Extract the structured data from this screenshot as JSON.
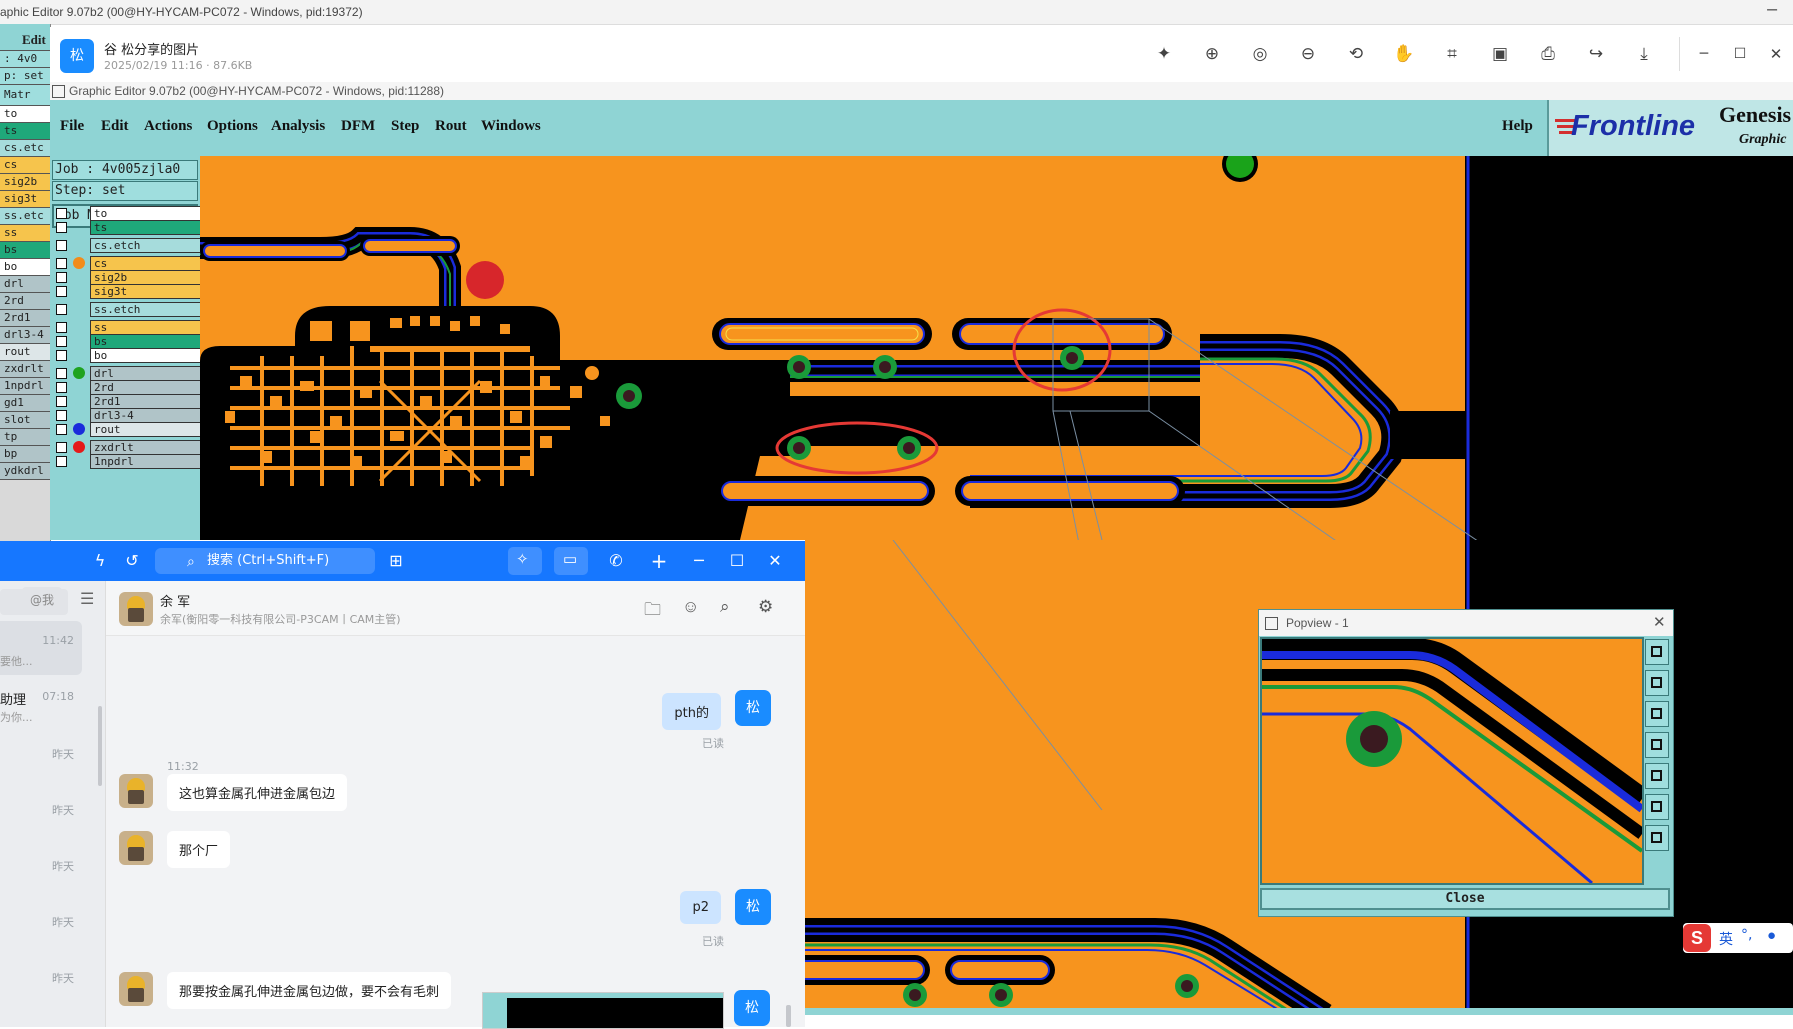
{
  "back_window": {
    "title": "aphic Editor 9.07b2 (00@HY-HYCAM-PC072 - Windows, pid:19372)",
    "menu_edit": "Edit",
    "job_fragment": ": 4v0",
    "step_fragment": "p: set",
    "matrix_fragment": "Matr",
    "layers": [
      "to",
      "ts",
      "cs.etc",
      "cs",
      "sig2b",
      "sig3t",
      "ss.etc",
      "ss",
      "bs",
      "bo",
      "drl",
      "2rd",
      "2rd1",
      "drl3-4",
      "rout",
      "zxdrlt",
      "1npdrl",
      "gd1",
      "slot",
      "tp",
      "bp",
      "ydkdrl"
    ]
  },
  "viewer": {
    "avatar_label": "松",
    "title": "谷 松分享的图片",
    "meta": "2025/02/19 11:16 · 87.6KB",
    "toolbar_icons": [
      "magic-wand-icon",
      "zoom-in-icon",
      "actual-size-icon",
      "zoom-out-icon",
      "rotate-icon",
      "hand-icon",
      "crop-icon",
      "ocr-icon",
      "print-icon",
      "share-icon",
      "download-icon"
    ],
    "window_icons": [
      "minimize-icon",
      "maximize-icon",
      "close-icon"
    ]
  },
  "genesis": {
    "title": "Graphic Editor 9.07b2 (00@HY-HYCAM-PC072 - Windows, pid:11288)",
    "menu": [
      "File",
      "Edit",
      "Actions",
      "Options",
      "Analysis",
      "DFM",
      "Step",
      "Rout",
      "Windows"
    ],
    "help": "Help",
    "logo": "Frontline",
    "logo_right_top": "Genesis",
    "logo_right_bottom": "Graphic",
    "job": "Job : 4v005zjla0",
    "step": "Step: set",
    "job_matrix": "Job Matrix ...",
    "layers": [
      {
        "name": "to",
        "color": "#ffffff",
        "dot": ""
      },
      {
        "name": "ts",
        "color": "#1fa87a",
        "dot": ""
      },
      {
        "name": "cs.etch",
        "color": "#a6dcdc",
        "dot": ""
      },
      {
        "name": "cs",
        "color": "#f6c44c",
        "dot": "#f28c1a"
      },
      {
        "name": "sig2b",
        "color": "#f6c44c",
        "dot": ""
      },
      {
        "name": "sig3t",
        "color": "#f6c44c",
        "dot": ""
      },
      {
        "name": "ss.etch",
        "color": "#a6dcdc",
        "dot": ""
      },
      {
        "name": "ss",
        "color": "#f6c44c",
        "dot": ""
      },
      {
        "name": "bs",
        "color": "#1fa87a",
        "dot": ""
      },
      {
        "name": "bo",
        "color": "#ffffff",
        "dot": ""
      },
      {
        "name": "drl",
        "color": "#b0c4c8",
        "dot": "#1fa31f"
      },
      {
        "name": "2rd",
        "color": "#b0c4c8",
        "dot": ""
      },
      {
        "name": "2rd1",
        "color": "#b0c4c8",
        "dot": ""
      },
      {
        "name": "drl3-4",
        "color": "#b0c4c8",
        "dot": ""
      },
      {
        "name": "rout",
        "color": "#dde6e8",
        "dot": "#1a2bdb"
      },
      {
        "name": "zxdrlt",
        "color": "#b0c4c8",
        "dot": "#e51a1a"
      },
      {
        "name": "1npdrl",
        "color": "#b0c4c8",
        "dot": ""
      }
    ],
    "popview": {
      "title": "Popview - 1",
      "close_button": "Close",
      "side_icons": [
        "zoom-home-icon",
        "pan-up-icon",
        "pan-down-icon",
        "pan-left-icon",
        "pan-right-icon",
        "zoom-fit-icon",
        "zoom-center-icon"
      ]
    },
    "colors": {
      "board": "#f7941e",
      "background": "#000000",
      "menu": "#8fd4d4",
      "trace": "#1a2bdb",
      "pad": "#1a9a3a",
      "marker": "#e53935"
    }
  },
  "chat": {
    "search_placeholder": "搜索 (Ctrl+Shift+F)",
    "list_filter": "@我",
    "list_items": [
      {
        "name": "",
        "time": "11:42",
        "preview": "要他..."
      },
      {
        "name": "助理",
        "time": "07:18",
        "preview": "为你..."
      },
      {
        "name": "",
        "time": "昨天",
        "preview": ""
      },
      {
        "name": "",
        "time": "昨天",
        "preview": ""
      },
      {
        "name": "",
        "time": "昨天",
        "preview": ""
      },
      {
        "name": "",
        "time": "昨天",
        "preview": ""
      },
      {
        "name": "",
        "time": "昨天",
        "preview": ""
      }
    ],
    "contact_name": "余 军",
    "contact_org": "余军(衡阳零一科技有限公司-P3CAM丨CAM主管)",
    "my_avatar": "松",
    "read_label": "已读",
    "messages": [
      {
        "from": "me",
        "text": "pth的"
      },
      {
        "from": "other",
        "time": "11:32",
        "text": "这也算金属孔伸进金属包边"
      },
      {
        "from": "other",
        "text": "那个厂"
      },
      {
        "from": "me",
        "text": "p2"
      },
      {
        "from": "other",
        "text": "那要按金属孔伸进金属包边做，要不会有毛刺"
      }
    ],
    "header_icons": [
      "folder-icon",
      "add-member-icon",
      "search-history-icon",
      "settings-icon"
    ]
  },
  "ime": {
    "logo": "S",
    "lang": "英",
    "punct": "°,"
  }
}
